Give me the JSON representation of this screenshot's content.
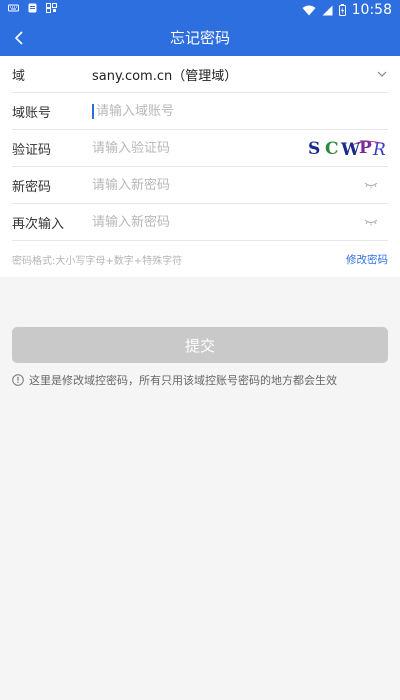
{
  "status_bar": {
    "time": "10:58"
  },
  "app_bar": {
    "title": "忘记密码"
  },
  "form": {
    "domain": {
      "label": "域",
      "value": "sany.com.cn（管理域）"
    },
    "account": {
      "label": "域账号",
      "placeholder": "请输入域账号"
    },
    "captcha": {
      "label": "验证码",
      "placeholder": "请输入验证码",
      "image_text": "SCWPR"
    },
    "new_password": {
      "label": "新密码",
      "placeholder": "请输入新密码"
    },
    "confirm_password": {
      "label": "再次输入",
      "placeholder": "请输入新密码"
    }
  },
  "hints": {
    "format": "密码格式:大小写字母+数字+特殊字符",
    "modify_link": "修改密码"
  },
  "submit_label": "提交",
  "note": "这里是修改域控密码，所有只用该域控账号密码的地方都会生效",
  "colors": {
    "primary": "#2e6fe0",
    "disabled_button": "#c9c9c9"
  }
}
